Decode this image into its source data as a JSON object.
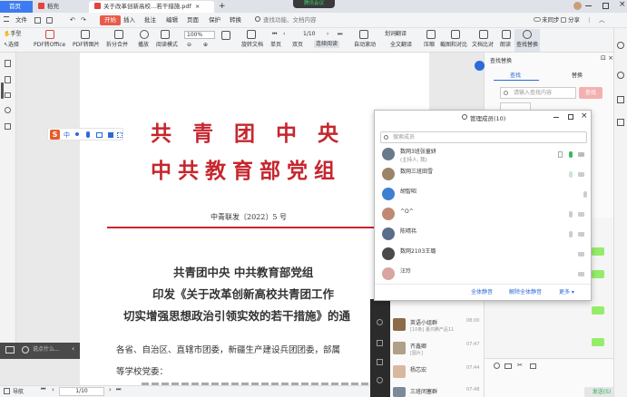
{
  "tabs": {
    "home": "首页",
    "draw": "稻壳",
    "pdf": "关于改革创新高校...若干措施.pdf",
    "add": "+"
  },
  "meeting_badge": "腾讯会议",
  "window": {
    "sync": "未同步",
    "share": "分享"
  },
  "menu": {
    "file": "文件",
    "start": "开始",
    "insert": "插入",
    "comment": "批注",
    "edit": "编辑",
    "page": "页面",
    "protect": "保护",
    "convert": "转换",
    "search_placeholder": "查找功能、文档内容"
  },
  "toolbar": {
    "hand": "手型",
    "select": "选择",
    "pdf_to_office": "PDF转Office",
    "pdf_to_image": "PDF转图片",
    "split_merge": "拆分合并",
    "play": "播放",
    "read_mode": "阅读模式",
    "zoom": "100%",
    "page": "1/10",
    "rotate": "旋转文档",
    "single": "单页",
    "double": "双页",
    "continuous": "连续阅读",
    "autoscroll": "自动滚动",
    "translate": "划词翻译",
    "full_translate": "全文翻译",
    "compress": "压缩",
    "screenshot_compare": "截图和对比",
    "doc_compare": "文档比对",
    "read_aloud": "朗读",
    "find_replace": "查找替换"
  },
  "document": {
    "title1": "共青团中央",
    "title2": "中共教育部党组",
    "doc_number": "中青联发〔2022〕5 号",
    "heading1": "共青团中央  中共教育部党组",
    "heading2": "印发《关于改革创新高校共青团工作",
    "heading3": "切实增强思想政治引领实效的若干措施》的通",
    "body1": "各省、自治区、直辖市团委，新疆生产建设兵团团委，部属",
    "body2": "等学校党委："
  },
  "ime": {
    "s": "S",
    "zh": "中"
  },
  "right_panel": {
    "title": "查找替换",
    "tab_find": "查找",
    "tab_replace": "替换",
    "search_placeholder": "请输入查找内容",
    "search_btn": "查找"
  },
  "popup": {
    "title": "管理成员(10)",
    "search_placeholder": "搜索成员",
    "members": [
      {
        "name": "数网3班张童妍",
        "sub": "(主持人, 我)"
      },
      {
        "name": "数网三班田雪",
        "sub": ""
      },
      {
        "name": "胡智昭",
        "sub": ""
      },
      {
        "name": "^O^",
        "sub": ""
      },
      {
        "name": "陈晴祎",
        "sub": ""
      },
      {
        "name": "数网2103王璐",
        "sub": ""
      },
      {
        "name": "汪玲",
        "sub": ""
      }
    ],
    "mute_all": "全体静音",
    "unmute_all": "解除全体静音",
    "more": "更多"
  },
  "chat": {
    "items": [
      {
        "name": "英语小组群",
        "sub": "[10条] 董鸿腾产品11",
        "time": "08:00"
      },
      {
        "name": "齐鑫卿",
        "sub": "[图片]",
        "time": "07:47"
      },
      {
        "name": "杨芯宏",
        "sub": "",
        "time": "07:44"
      },
      {
        "name": "三班闭塞群",
        "sub": "",
        "time": "07:48"
      }
    ],
    "send": "发送(S)"
  },
  "comment_placeholder": "说点什么...",
  "status": {
    "nav": "导航",
    "page": "1/10"
  }
}
